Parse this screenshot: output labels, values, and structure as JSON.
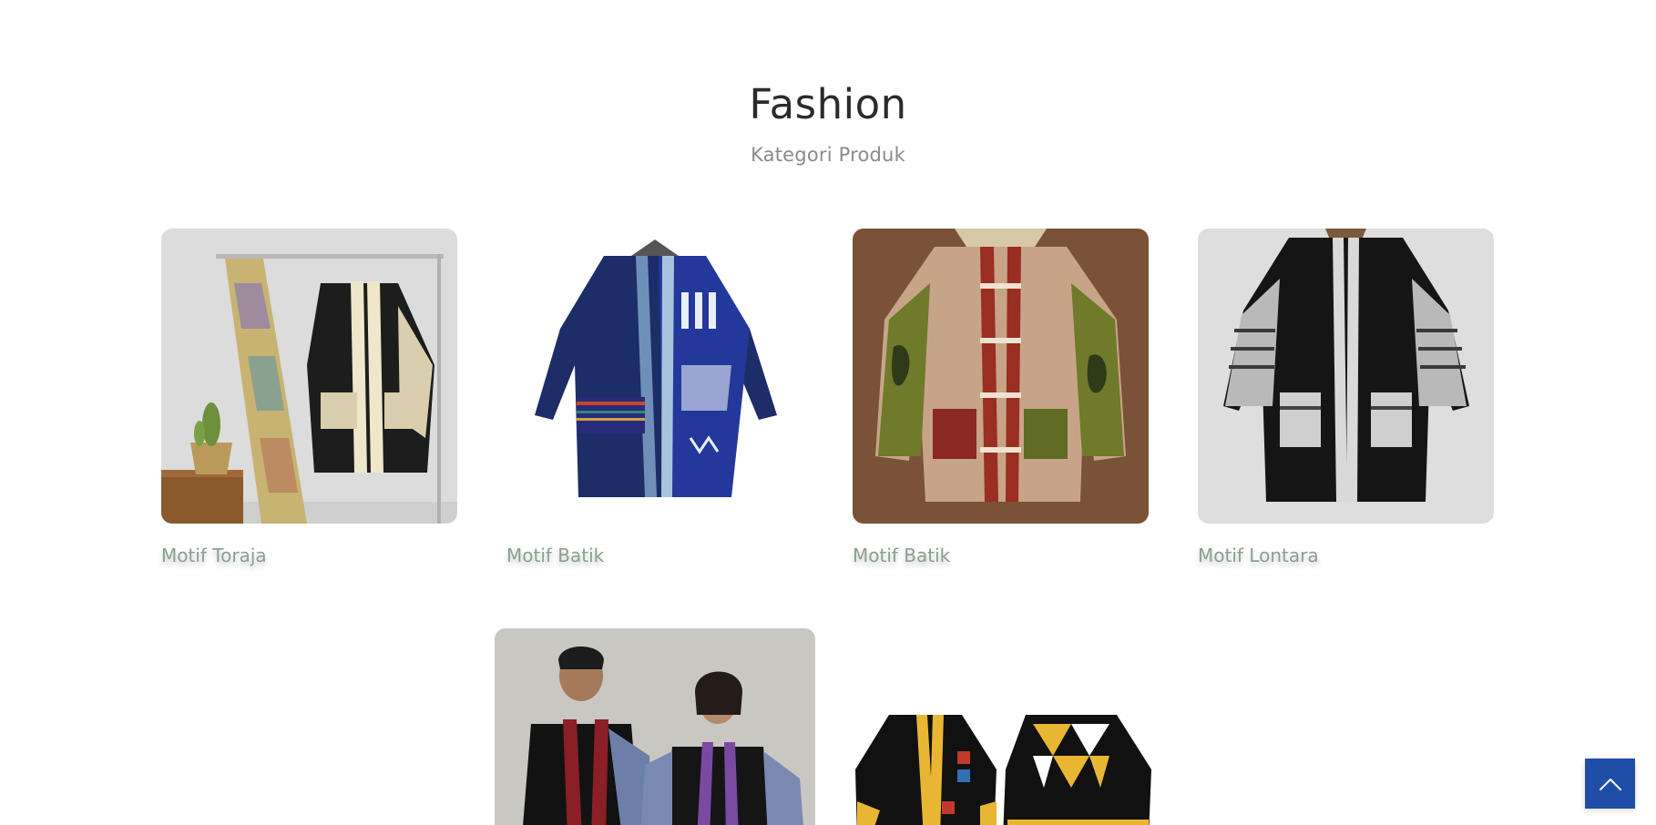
{
  "section": {
    "title": "Fashion",
    "subtitle": "Kategori Produk"
  },
  "products": [
    {
      "label": "Motif Toraja"
    },
    {
      "label": "Motif Batik"
    },
    {
      "label": "Motif Batik"
    },
    {
      "label": "Motif Lontara"
    },
    {
      "label": ""
    },
    {
      "label": ""
    }
  ],
  "back_to_top": {
    "icon": "chevron-up-icon",
    "color": "#1e4ea8"
  },
  "colors": {
    "caption": "#8aa08f",
    "title": "#2b2b2b",
    "subtitle": "#8a8a8a"
  }
}
